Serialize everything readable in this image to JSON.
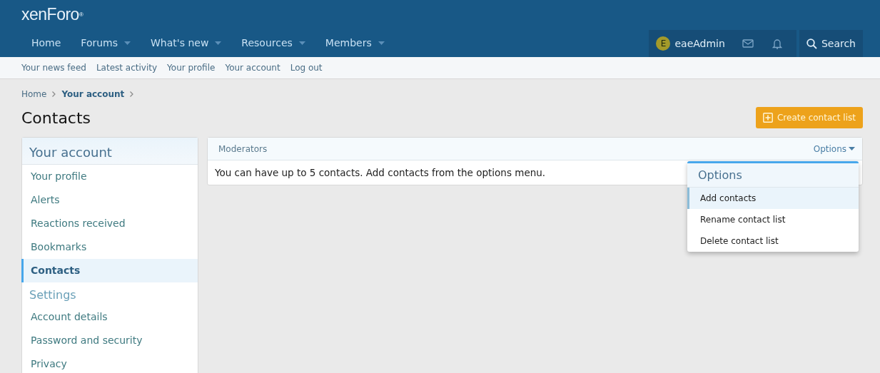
{
  "logo": "xenForo$^{®}$",
  "nav": [
    {
      "label": "Home",
      "dropdown": false
    },
    {
      "label": "Forums",
      "dropdown": true
    },
    {
      "label": "What's new",
      "dropdown": true
    },
    {
      "label": "Resources",
      "dropdown": true
    },
    {
      "label": "Members",
      "dropdown": true
    }
  ],
  "user": {
    "avatar_letter": "E",
    "name": "eaeAdmin"
  },
  "search": {
    "label": "Search"
  },
  "subnav": [
    "Your news feed",
    "Latest activity",
    "Your profile",
    "Your account",
    "Log out"
  ],
  "breadcrumb": [
    {
      "label": "Home",
      "current": false
    },
    {
      "label": "Your account",
      "current": true
    }
  ],
  "page_title": "Contacts",
  "create_button": "Create contact list",
  "sidebar": [
    {
      "kind": "title",
      "label": "Your account"
    },
    {
      "kind": "item",
      "label": "Your profile",
      "selected": false
    },
    {
      "kind": "item",
      "label": "Alerts",
      "selected": false
    },
    {
      "kind": "item",
      "label": "Reactions received",
      "selected": false
    },
    {
      "kind": "item",
      "label": "Bookmarks",
      "selected": false
    },
    {
      "kind": "item",
      "label": "Contacts",
      "selected": true
    },
    {
      "kind": "header",
      "label": "Settings"
    },
    {
      "kind": "item",
      "label": "Account details",
      "selected": false
    },
    {
      "kind": "item",
      "label": "Password and security",
      "selected": false
    },
    {
      "kind": "item",
      "label": "Privacy",
      "selected": false
    }
  ],
  "panel": {
    "title": "Moderators",
    "options_label": "Options",
    "message": "You can have up to 5 contacts. Add contacts from the options menu."
  },
  "menu": {
    "title": "Options",
    "items": [
      {
        "label": "Add contacts",
        "selected": true
      },
      {
        "label": "Rename contact list",
        "selected": false
      },
      {
        "label": "Delete contact list",
        "selected": false
      }
    ]
  }
}
